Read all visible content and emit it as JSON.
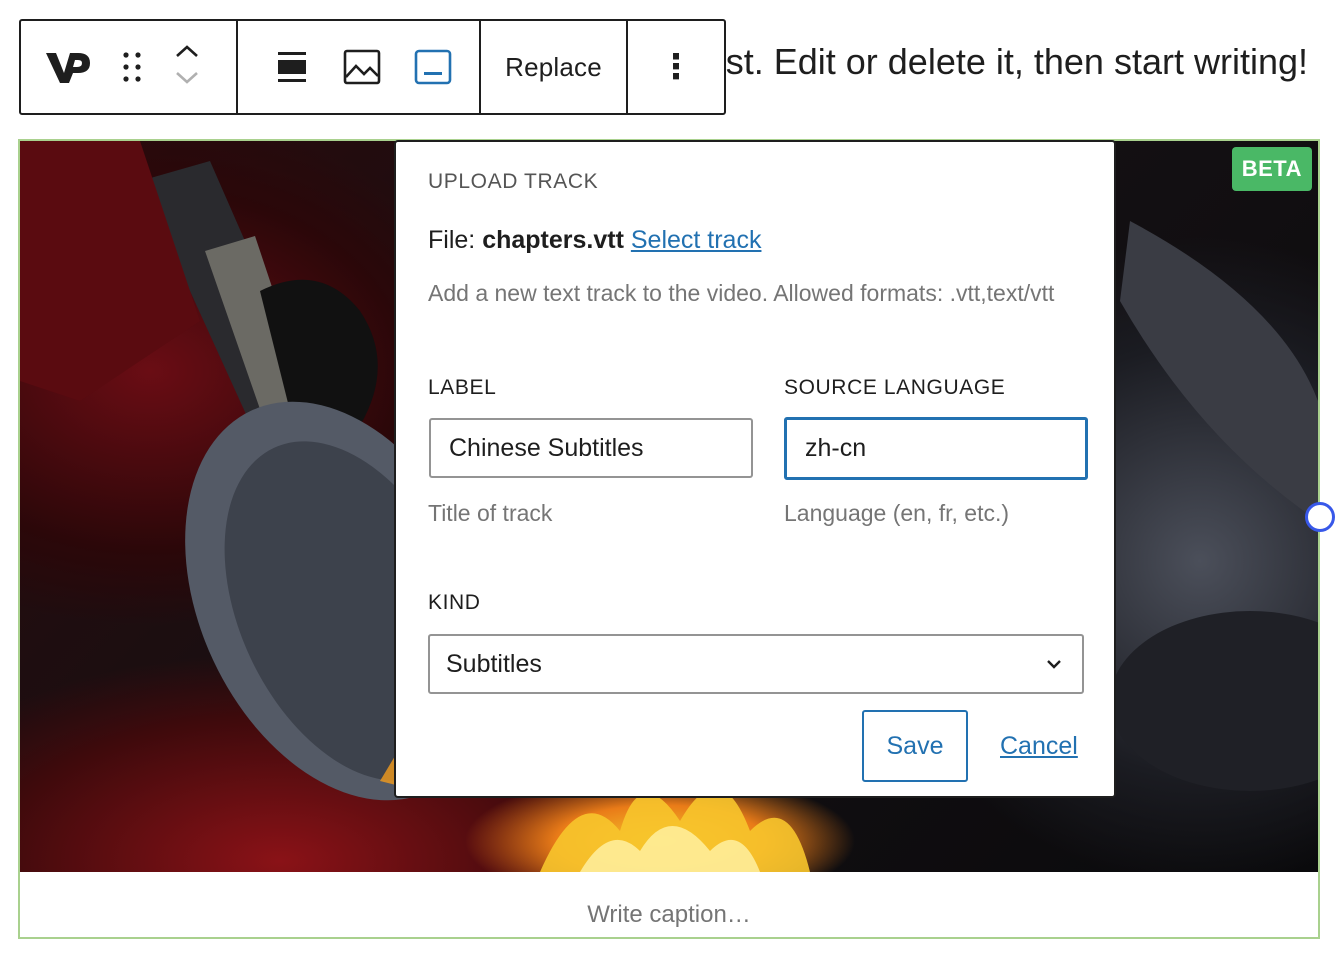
{
  "post": {
    "text": "This is your first post. Edit or delete it, then start writing!"
  },
  "toolbar": {
    "logo_text": "VP",
    "replace_label": "Replace",
    "more_label": "⋮"
  },
  "video": {
    "beta_badge": "BETA",
    "caption_placeholder": "Write caption…"
  },
  "popover": {
    "title": "UPLOAD TRACK",
    "file_prefix": "File: ",
    "file_name": "chapters.vtt",
    "select_track_link": "Select track",
    "help_text": "Add a new text track to the video. Allowed formats: .vtt,text/vtt",
    "label_field": {
      "label": "LABEL",
      "value": "Chinese Subtitles",
      "hint": "Title of track"
    },
    "language_field": {
      "label": "SOURCE LANGUAGE",
      "value": "zh-cn",
      "hint": "Language (en, fr, etc.)"
    },
    "kind_field": {
      "label": "KIND",
      "selected": "Subtitles"
    },
    "save_label": "Save",
    "cancel_label": "Cancel"
  },
  "colors": {
    "accent": "#2271b1",
    "beta_green": "#4ab866",
    "block_outline": "#a9d18e",
    "handle": "#3858e9"
  }
}
